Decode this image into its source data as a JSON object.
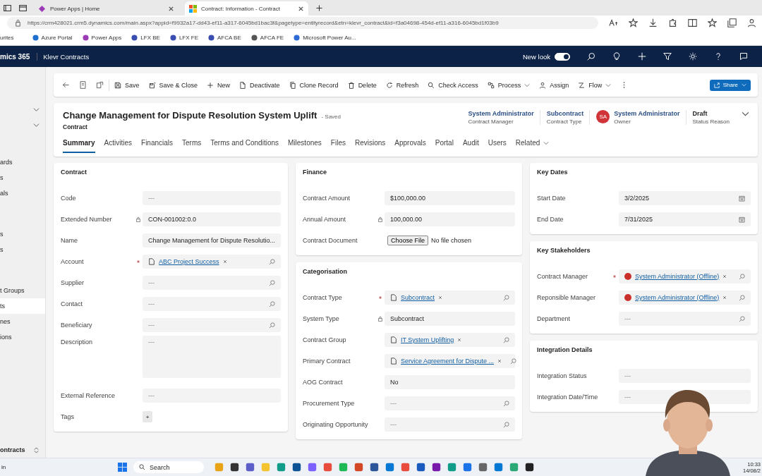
{
  "browser": {
    "tabs": [
      {
        "title": "Power Apps | Home",
        "selected": false
      },
      {
        "title": "Contract: Information - Contract",
        "selected": true
      }
    ],
    "url": "https://crm428021.crm5.dynamics.com/main.aspx?appid=f9932a17-dd43-ef11-a317-6045bd1bac3f&pagetype=entityrecord&etn=klevr_contract&id=f3a04698-454d-ef11-a316-6045bd1f03b9",
    "favorites_label": "urites",
    "favorites": [
      "Azure Portal",
      "Power Apps",
      "LFX BE",
      "LFX FE",
      "AFCA BE",
      "AFCA FE",
      "Microsoft Power Au..."
    ]
  },
  "app": {
    "product": "mics 365",
    "app_name": "Klevr Contracts",
    "new_look": {
      "label": "New look",
      "on": true
    }
  },
  "sidebar": {
    "groups": [
      {
        "items": [
          {
            "label": "ards",
            "selected": false
          },
          {
            "label": "s",
            "selected": false
          },
          {
            "label": "als",
            "selected": false
          }
        ]
      },
      {
        "items": [
          {
            "label": "s",
            "selected": false
          },
          {
            "label": "s",
            "selected": false
          }
        ]
      },
      {
        "items": [
          {
            "label": "t Groups",
            "selected": false
          },
          {
            "label": "ts",
            "selected": true
          },
          {
            "label": "nes",
            "selected": false
          },
          {
            "label": "ions",
            "selected": false
          }
        ]
      }
    ],
    "area": "ontracts"
  },
  "commands": [
    {
      "label": "Save",
      "dropdown": false
    },
    {
      "label": "Save & Close",
      "dropdown": false
    },
    {
      "label": "New",
      "dropdown": false
    },
    {
      "label": "Deactivate",
      "dropdown": false
    },
    {
      "label": "Clone Record",
      "dropdown": false
    },
    {
      "label": "Delete",
      "dropdown": false
    },
    {
      "label": "Refresh",
      "dropdown": false
    },
    {
      "label": "Check Access",
      "dropdown": false
    },
    {
      "label": "Process",
      "dropdown": true
    },
    {
      "label": "Assign",
      "dropdown": false
    },
    {
      "label": "Flow",
      "dropdown": true
    }
  ],
  "share": "Share",
  "record": {
    "title": "Change Management for Dispute Resolution System Uplift",
    "saved": "- Saved",
    "entity": "Contract",
    "header_fields": [
      {
        "value": "System Administrator",
        "label": "Contract Manager"
      },
      {
        "value": "Subcontract",
        "label": "Contract Type"
      },
      {
        "value": "System Administrator",
        "label": "Owner",
        "avatar": "SA"
      },
      {
        "value": "Draft",
        "label": "Status Reason"
      }
    ]
  },
  "tabs": [
    {
      "label": "Summary",
      "selected": true,
      "dropdown": false
    },
    {
      "label": "Activities",
      "selected": false,
      "dropdown": false
    },
    {
      "label": "Financials",
      "selected": false,
      "dropdown": false
    },
    {
      "label": "Terms",
      "selected": false,
      "dropdown": false
    },
    {
      "label": "Terms and Conditions",
      "selected": false,
      "dropdown": false
    },
    {
      "label": "Milestones",
      "selected": false,
      "dropdown": false
    },
    {
      "label": "Files",
      "selected": false,
      "dropdown": false
    },
    {
      "label": "Revisions",
      "selected": false,
      "dropdown": false
    },
    {
      "label": "Approvals",
      "selected": false,
      "dropdown": false
    },
    {
      "label": "Portal",
      "selected": false,
      "dropdown": false
    },
    {
      "label": "Audit",
      "selected": false,
      "dropdown": false
    },
    {
      "label": "Users",
      "selected": false,
      "dropdown": false
    },
    {
      "label": "Related",
      "selected": false,
      "dropdown": true
    }
  ],
  "columns": [
    [
      {
        "title": "Contract",
        "fields": [
          {
            "kind": "text",
            "label": "Code",
            "placeholder": "---"
          },
          {
            "kind": "text",
            "label": "Extended Number",
            "locked": true,
            "value": "CON-001002:0.0"
          },
          {
            "kind": "text",
            "label": "Name",
            "value": "Change Management for Dispute Resolutio..."
          },
          {
            "kind": "lookup",
            "label": "Account",
            "required": true,
            "value": "ABC Project Success"
          },
          {
            "kind": "lookup",
            "label": "Supplier",
            "placeholder": "---"
          },
          {
            "kind": "lookup",
            "label": "Contact",
            "placeholder": "---"
          },
          {
            "kind": "lookup",
            "label": "Beneficiary",
            "placeholder": "---"
          },
          {
            "kind": "textarea",
            "label": "Description",
            "placeholder": "---"
          },
          {
            "kind": "text",
            "label": "External Reference",
            "placeholder": "---"
          },
          {
            "kind": "tags",
            "label": "Tags",
            "button": "+"
          }
        ]
      }
    ],
    [
      {
        "title": "Finance",
        "fields": [
          {
            "kind": "text",
            "label": "Contract Amount",
            "value": "$100,000.00"
          },
          {
            "kind": "text",
            "label": "Annual Amount",
            "locked": true,
            "value": "100,000.00"
          },
          {
            "kind": "file",
            "label": "Contract Document",
            "button": "Choose File",
            "status": "No file chosen"
          }
        ]
      },
      {
        "title": "Categorisation",
        "fields": [
          {
            "kind": "lookup",
            "label": "Contract Type",
            "required": true,
            "value": "Subcontract"
          },
          {
            "kind": "text",
            "label": "System Type",
            "locked": true,
            "value": "Subcontract"
          },
          {
            "kind": "lookup",
            "label": "Contract Group",
            "value": "IT System Uplifting"
          },
          {
            "kind": "lookup",
            "label": "Primary Contract",
            "value": "Service Agreement for Dispute ..."
          },
          {
            "kind": "text",
            "label": "AOG Contract",
            "value": "No"
          },
          {
            "kind": "lookup",
            "label": "Procurement Type",
            "placeholder": "---"
          },
          {
            "kind": "lookup",
            "label": "Originating Opportunity",
            "placeholder": "---"
          }
        ]
      }
    ],
    [
      {
        "title": "Key Dates",
        "fields": [
          {
            "kind": "date",
            "label": "Start Date",
            "value": "3/2/2025"
          },
          {
            "kind": "date",
            "label": "End Date",
            "value": "7/31/2025"
          }
        ]
      },
      {
        "title": "Key Stakeholders",
        "fields": [
          {
            "kind": "user_lookup",
            "label": "Contract Manager",
            "required": true,
            "value": "System Administrator (Offline)"
          },
          {
            "kind": "user_lookup",
            "label": "Reponsible Manager",
            "value": "System Administrator (Offline)"
          },
          {
            "kind": "lookup",
            "label": "Department",
            "placeholder": "---"
          }
        ]
      },
      {
        "title": "Integration Details",
        "fields": [
          {
            "kind": "text",
            "label": "Integration Status",
            "placeholder": "---"
          },
          {
            "kind": "text",
            "label": "Integration Date/Time",
            "placeholder": "---"
          }
        ]
      }
    ]
  ],
  "taskbar": {
    "corner": "in",
    "search": "Search",
    "time": "10:33",
    "date": "14/08/2"
  },
  "overlay": {
    "kind": "picture"
  }
}
